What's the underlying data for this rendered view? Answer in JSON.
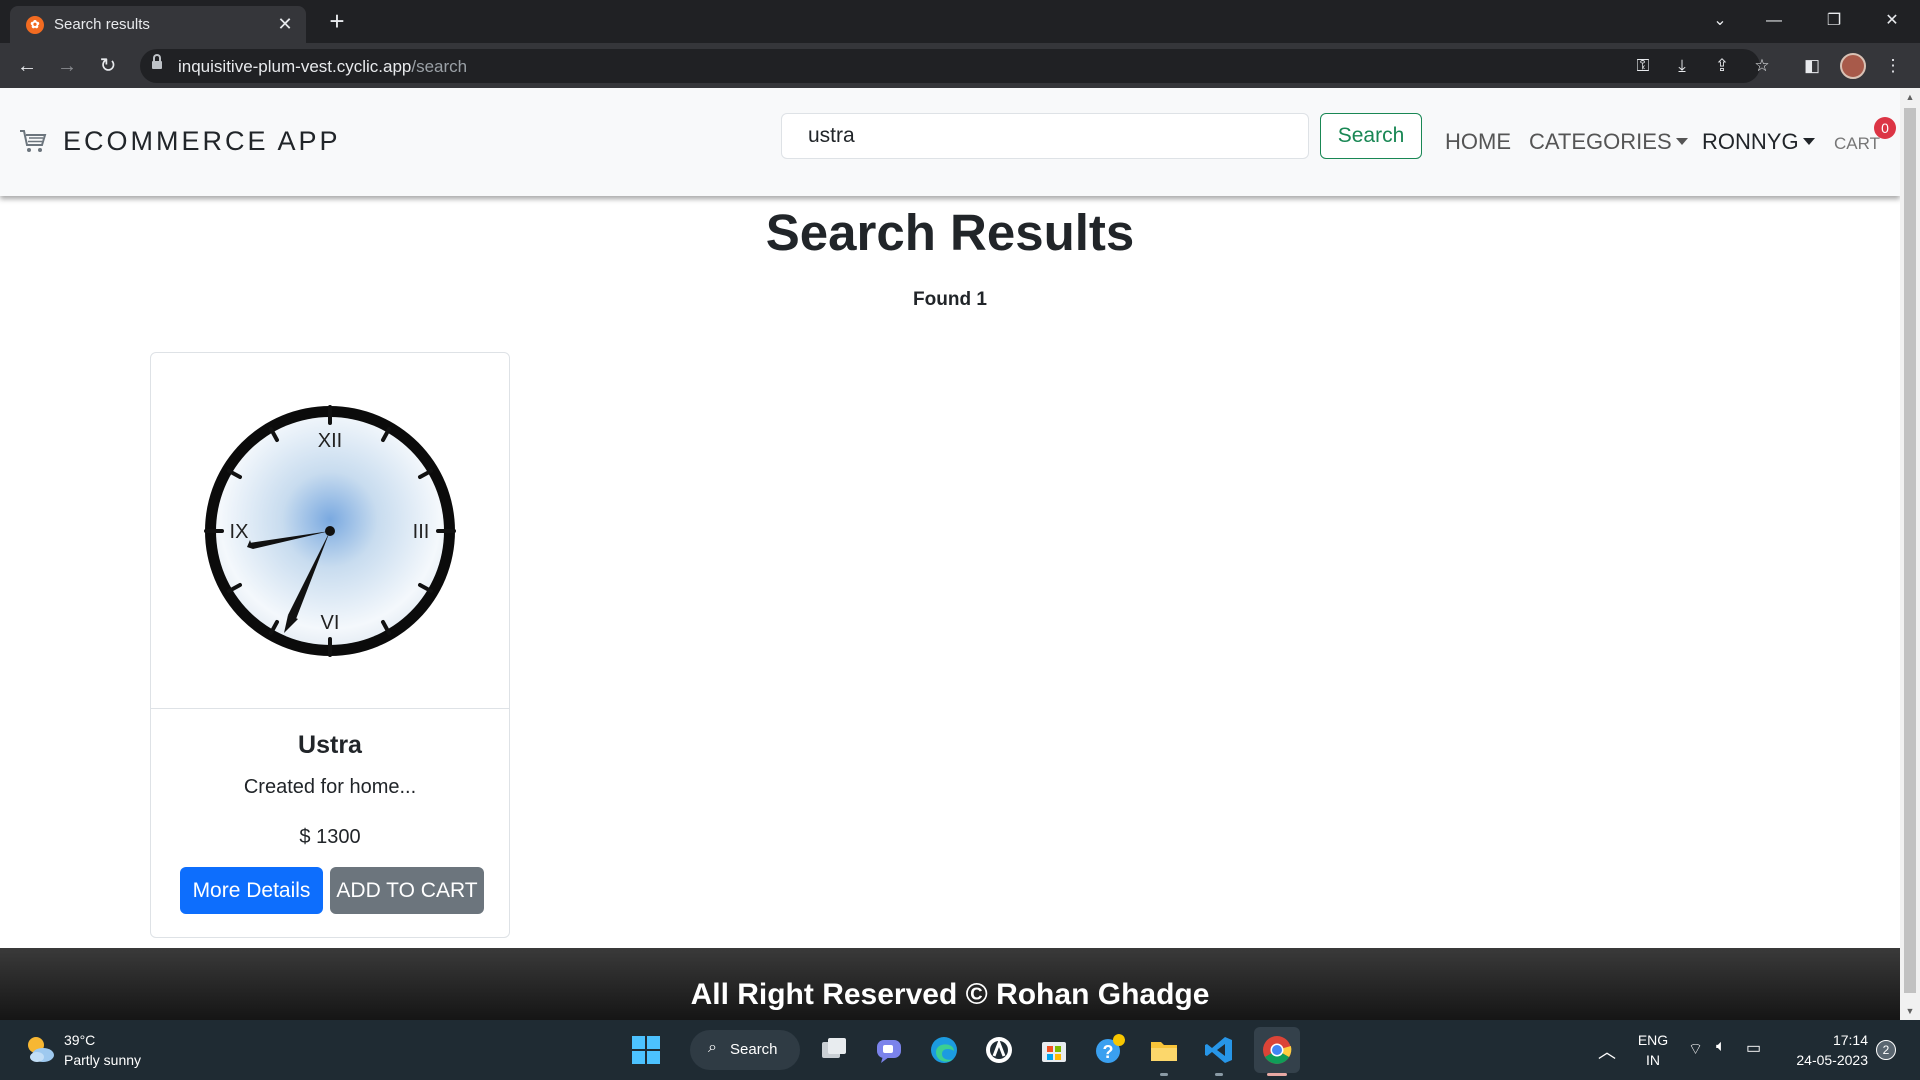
{
  "browser": {
    "tab_title": "Search results",
    "url_host": "inquisitive-plum-vest.cyclic.app",
    "url_path": "/search"
  },
  "nav": {
    "brand": "ECOMMERCE APP",
    "search_value": "ustra",
    "search_button": "Search",
    "home": "HOME",
    "categories": "CATEGORIES",
    "user": "RONNYG",
    "cart": "CART",
    "cart_count": "0"
  },
  "results": {
    "title": "Search Results",
    "found": "Found 1",
    "products": [
      {
        "name": "Ustra",
        "description": "Created for home...",
        "price": "$ 1300",
        "details_button": "More Details",
        "cart_button": "ADD TO CART",
        "image_icon": "wall-clock-image",
        "clock_numerals": [
          "XII",
          "III",
          "VI",
          "IX"
        ]
      }
    ]
  },
  "footer": {
    "text": "All Right Reserved © Rohan Ghadge"
  },
  "taskbar": {
    "weather_temp": "39°C",
    "weather_desc": "Partly sunny",
    "search_label": "Search",
    "lang_line1": "ENG",
    "lang_line2": "IN",
    "time": "17:14",
    "date": "24-05-2023",
    "notification_count": "2"
  },
  "colors": {
    "success": "#198754",
    "primary": "#0d6efd",
    "secondary": "#6c757d",
    "danger": "#dc3545"
  }
}
